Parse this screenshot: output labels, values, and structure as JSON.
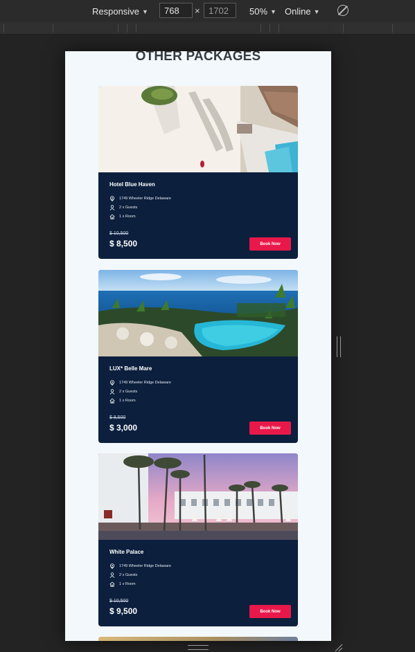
{
  "devtools": {
    "device": "Responsive",
    "width": "768",
    "height": "1702",
    "separator": "×",
    "zoom": "50%",
    "network": "Online"
  },
  "section": {
    "title": "OTHER PACKAGES"
  },
  "packages": [
    {
      "name": "Hotel Blue Haven",
      "address": "1749 Wheeler Ridge Delaware",
      "guests": "2 x Guests",
      "rooms": "1 x Room",
      "old_price": "$ 10,500",
      "price": "$ 8,500",
      "cta": "Book Now"
    },
    {
      "name": "LUX* Belle Mare",
      "address": "1749 Wheeler Ridge Delaware",
      "guests": "2 x Guests",
      "rooms": "1 x Room",
      "old_price": "$ 8,500",
      "price": "$ 3,000",
      "cta": "Book Now"
    },
    {
      "name": "White Palace",
      "address": "1749 Wheeler Ridge Delaware",
      "guests": "2 x Guests",
      "rooms": "1 x Room",
      "old_price": "$ 10,500",
      "price": "$ 9,500",
      "cta": "Book Now"
    }
  ],
  "colors": {
    "card_bg": "#0c1f3d",
    "button": "#e8194a",
    "page_bg": "#f3f8fc"
  }
}
